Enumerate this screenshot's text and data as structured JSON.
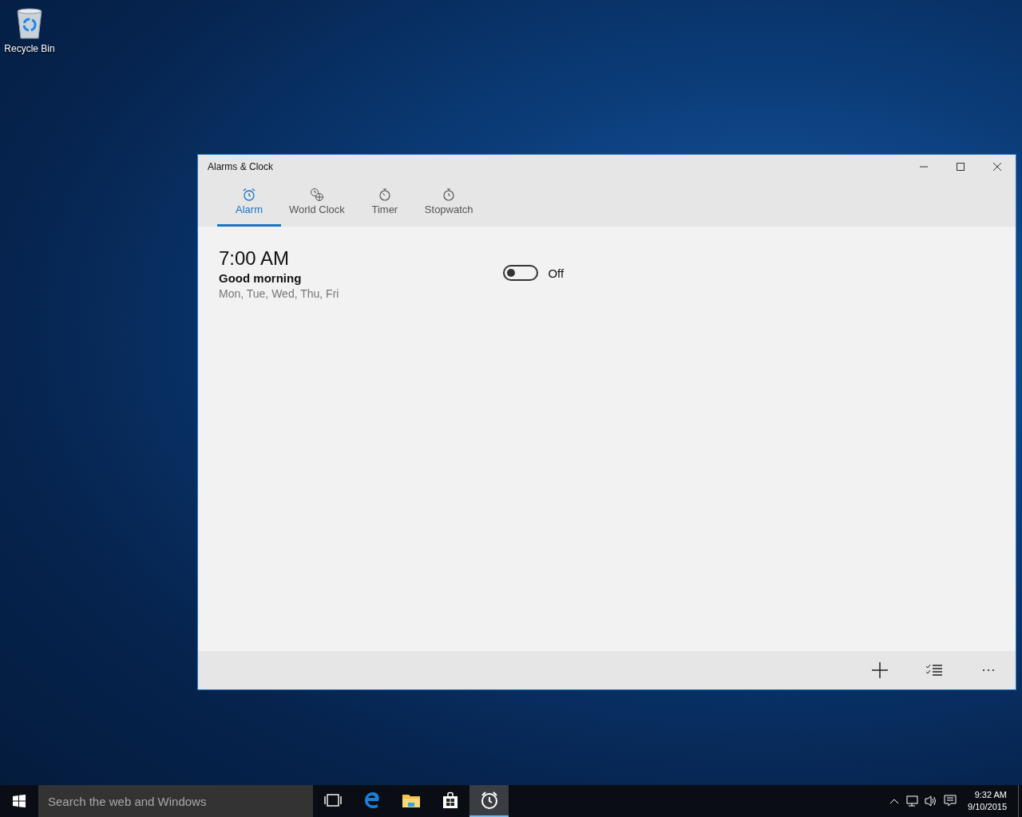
{
  "desktop_icons": [
    {
      "label": "Recycle Bin"
    }
  ],
  "window": {
    "title": "Alarms & Clock"
  },
  "tabs": [
    {
      "label": "Alarm",
      "kind": "alarm",
      "selected": true
    },
    {
      "label": "World Clock",
      "kind": "world",
      "selected": false
    },
    {
      "label": "Timer",
      "kind": "timer",
      "selected": false
    },
    {
      "label": "Stopwatch",
      "kind": "stopwatch",
      "selected": false
    }
  ],
  "alarms": [
    {
      "time": "7:00 AM",
      "name": "Good morning",
      "days": "Mon, Tue, Wed, Thu, Fri",
      "on": false,
      "state_label": "Off"
    }
  ],
  "taskbar": {
    "search": {
      "placeholder": "Search the web and Windows"
    },
    "apps": [
      {
        "kind": "taskview",
        "active": false
      },
      {
        "kind": "edge",
        "active": false
      },
      {
        "kind": "explorer",
        "active": false
      },
      {
        "kind": "store",
        "active": false
      },
      {
        "kind": "clock",
        "active": true
      }
    ],
    "time": "9:32 AM",
    "date": "9/10/2015"
  }
}
